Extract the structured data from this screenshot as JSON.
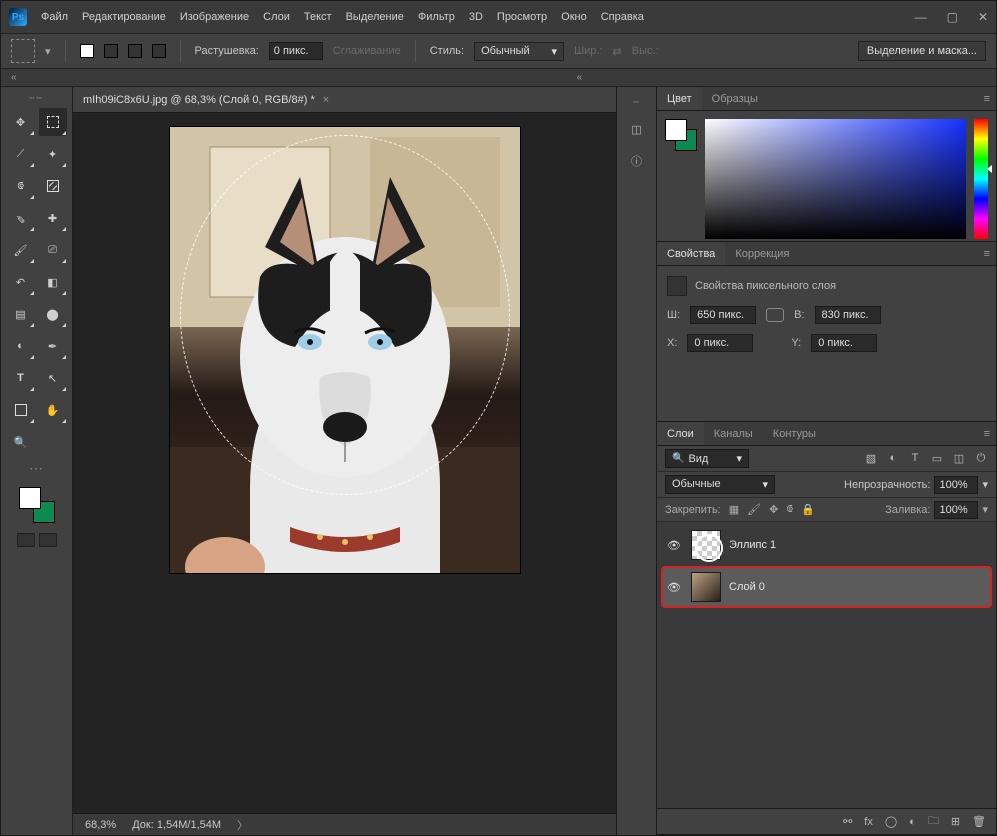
{
  "menu": [
    "Файл",
    "Редактирование",
    "Изображение",
    "Слои",
    "Текст",
    "Выделение",
    "Фильтр",
    "3D",
    "Просмотр",
    "Окно",
    "Справка"
  ],
  "options": {
    "feather_label": "Растушевка:",
    "feather_value": "0 пикс.",
    "antialias": "Сглаживание",
    "style_label": "Стиль:",
    "style_value": "Обычный",
    "w_label": "Шир.:",
    "h_label": "Выс.:",
    "select_mask": "Выделение и маска..."
  },
  "doc": {
    "tab": "mIh09iC8x6U.jpg @ 68,3% (Слой 0, RGB/8#) *"
  },
  "status": {
    "zoom": "68,3%",
    "docsize_label": "Док:",
    "docsize": "1,54M/1,54M"
  },
  "color_tabs": [
    "Цвет",
    "Образцы"
  ],
  "props_tabs": [
    "Свойства",
    "Коррекция"
  ],
  "props": {
    "title": "Свойства пиксельного слоя",
    "w_label": "Ш:",
    "w_value": "650 пикс.",
    "h_label": "В:",
    "h_value": "830 пикс.",
    "x_label": "X:",
    "x_value": "0 пикс.",
    "y_label": "Y:",
    "y_value": "0 пикс."
  },
  "layers_tabs": [
    "Слои",
    "Каналы",
    "Контуры"
  ],
  "layers": {
    "search": "Вид",
    "blend": "Обычные",
    "opacity_label": "Непрозрачность:",
    "opacity_value": "100%",
    "lock_label": "Закрепить:",
    "fill_label": "Заливка:",
    "fill_value": "100%",
    "items": [
      {
        "name": "Эллипс 1",
        "thumb": "ell",
        "selected": false
      },
      {
        "name": "Слой 0",
        "thumb": "dog",
        "selected": true
      }
    ]
  },
  "tools": [
    [
      "move",
      "marquee"
    ],
    [
      "lasso",
      "wand"
    ],
    [
      "crop",
      "frame"
    ],
    [
      "eyedrop",
      "heal"
    ],
    [
      "brush",
      "stamp"
    ],
    [
      "history",
      "eraser"
    ],
    [
      "grad",
      "blur"
    ],
    [
      "dodge",
      "pen"
    ],
    [
      "type",
      "path"
    ],
    [
      "rect",
      "hand"
    ],
    [
      "zoom",
      ""
    ]
  ]
}
